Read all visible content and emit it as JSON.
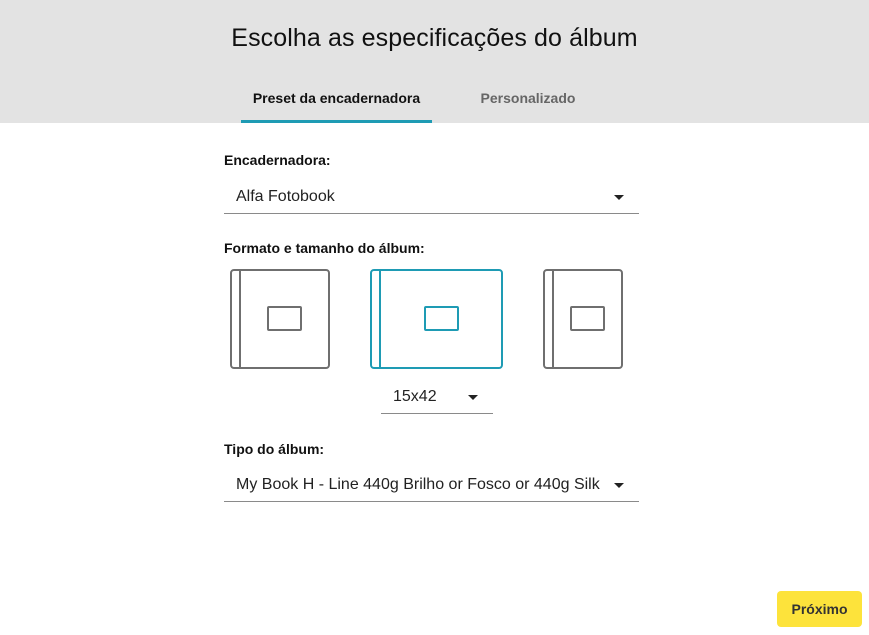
{
  "header": {
    "title": "Escolha as especificações do álbum",
    "tabs": [
      {
        "label": "Preset da encadernadora",
        "active": true
      },
      {
        "label": "Personalizado",
        "active": false
      }
    ]
  },
  "binder": {
    "label": "Encadernadora:",
    "value": "Alfa Fotobook"
  },
  "format": {
    "label": "Formato e tamanho do álbum:",
    "options": [
      {
        "name": "square",
        "selected": false
      },
      {
        "name": "landscape",
        "selected": true
      },
      {
        "name": "portrait",
        "selected": false
      }
    ],
    "size_value": "15x42"
  },
  "album_type": {
    "label": "Tipo do álbum:",
    "value": "My Book H - Line 440g Brilho or Fosco  or 440g Silk"
  },
  "footer": {
    "next_label": "Próximo"
  },
  "colors": {
    "accent": "#1e9bb4",
    "header_bg": "#e3e3e3",
    "button_bg": "#fde33b",
    "outline": "#6f6f6f"
  },
  "icons": [
    "dropdown-caret-icon"
  ]
}
